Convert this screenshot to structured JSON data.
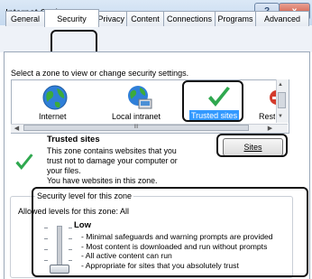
{
  "window": {
    "title": "Internet Options",
    "help_label": "?",
    "close_label": "x"
  },
  "tabs": [
    {
      "label": "General"
    },
    {
      "label": "Security"
    },
    {
      "label": "Privacy"
    },
    {
      "label": "Content"
    },
    {
      "label": "Connections"
    },
    {
      "label": "Programs"
    },
    {
      "label": "Advanced"
    }
  ],
  "security": {
    "zone_prompt": "Select a zone to view or change security settings.",
    "zones": [
      {
        "label": "Internet",
        "icon": "globe-icon"
      },
      {
        "label": "Local intranet",
        "icon": "network-globe-icon"
      },
      {
        "label": "Trusted sites",
        "icon": "green-check-icon",
        "selected": true
      },
      {
        "label": "Resti",
        "icon": "restricted-icon"
      }
    ],
    "scroll_thumb_label": "III",
    "selected_zone": {
      "title": "Trusted sites",
      "description_lines": [
        "This zone contains websites that you",
        "trust not to damage your computer or",
        "your files.",
        "You have websites in this zone."
      ]
    },
    "sites_button_label": "Sites",
    "level_group_title": "Security level for this zone",
    "allowed_levels_text": "Allowed levels for this zone: All",
    "level_name": "Low",
    "level_bullets": [
      "- Minimal safeguards and warning prompts are provided",
      "- Most content is downloaded and run without prompts",
      "- All active content can run",
      "- Appropriate for sites that you absolutely trust"
    ],
    "level_slider_position": "lowest"
  },
  "colors": {
    "accent_selected": "#3399ff",
    "check_green": "#2fa84f",
    "highlight_border": "#111111"
  }
}
